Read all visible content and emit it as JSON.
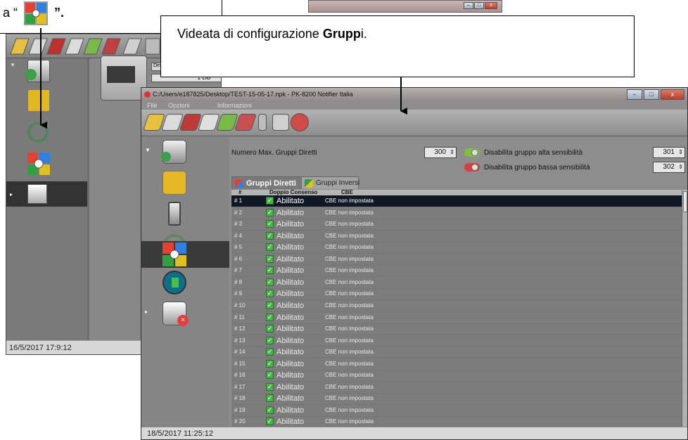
{
  "callouts": {
    "top_left_prefix": "a “",
    "top_left_suffix": "”.",
    "main_prefix": "Videata di configurazione ",
    "main_bold": "Grupp",
    "main_suffix": "i."
  },
  "back_window": {
    "combo_text": "1 LIB",
    "desc_stub": "Des",
    "status_time": "16/5/2017  17:9:12"
  },
  "window": {
    "title": "C:/Users/e187825/Desktop/TEST-15-05-17.npk - PK-8200 Notifier Italia",
    "menu": [
      "File",
      "Opzioni",
      "Informazioni"
    ],
    "status_time": "18/5/2017  11:25:12"
  },
  "config": {
    "max_direct_label": "Numero Max. Gruppi Diretti",
    "max_direct_value": "300",
    "high_sens_label": "Disabilita gruppo alta sensibilità",
    "high_sens_value": "301",
    "low_sens_label": "Disabilita gruppo bassa sensibilità",
    "low_sens_value": "302"
  },
  "tabs": {
    "active": "Gruppi Diretti",
    "inactive": "Gruppi Inversi"
  },
  "table": {
    "headers": [
      "#",
      "Doppio Consenso",
      "CBE"
    ],
    "status_label": "Abilitato",
    "cbe_label": "CBE non impostata",
    "rows": [
      "# 1",
      "# 2",
      "# 3",
      "# 4",
      "# 5",
      "# 6",
      "# 7",
      "# 8",
      "# 9",
      "# 10",
      "# 11",
      "# 12",
      "# 13",
      "# 14",
      "# 15",
      "# 16",
      "# 17",
      "# 18",
      "# 19",
      "# 20"
    ]
  },
  "icons": {
    "group_icon": "groups-icon",
    "toggle_high": "toggle-green-icon",
    "toggle_low": "toggle-red-icon"
  },
  "colors": {
    "selection": "#101826",
    "check": "#4bb34b"
  }
}
